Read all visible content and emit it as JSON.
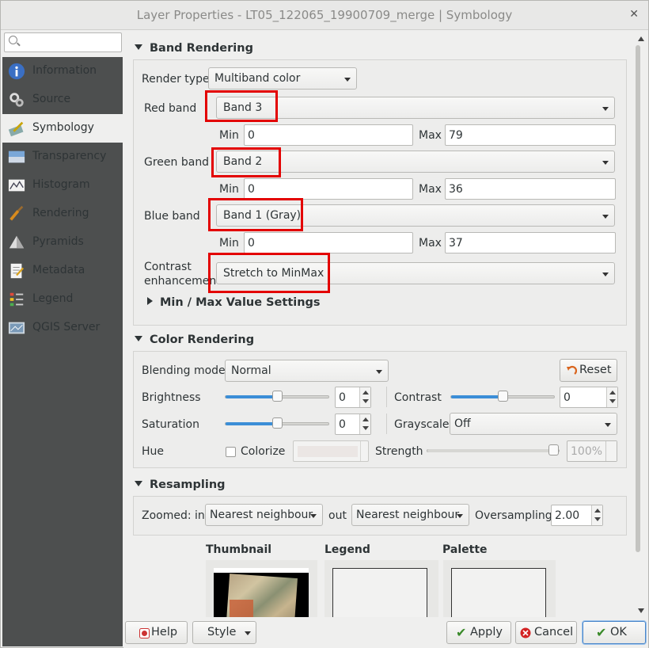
{
  "window": {
    "title": "Layer Properties - LT05_122065_19900709_merge | Symbology",
    "close_glyph": "✕"
  },
  "search": {
    "placeholder": ""
  },
  "sidebar": {
    "items": [
      {
        "label": "Information",
        "icon": "info-icon",
        "selected": false
      },
      {
        "label": "Source",
        "icon": "source-icon",
        "selected": false
      },
      {
        "label": "Symbology",
        "icon": "symbology-icon",
        "selected": true
      },
      {
        "label": "Transparency",
        "icon": "transparency-icon",
        "selected": false
      },
      {
        "label": "Histogram",
        "icon": "histogram-icon",
        "selected": false
      },
      {
        "label": "Rendering",
        "icon": "rendering-icon",
        "selected": false
      },
      {
        "label": "Pyramids",
        "icon": "pyramids-icon",
        "selected": false
      },
      {
        "label": "Metadata",
        "icon": "metadata-icon",
        "selected": false
      },
      {
        "label": "Legend",
        "icon": "legend-icon",
        "selected": false
      },
      {
        "label": "QGIS Server",
        "icon": "qgis-server-icon",
        "selected": false
      }
    ]
  },
  "band_rendering": {
    "header": "Band Rendering",
    "render_type_label": "Render type",
    "render_type_value": "Multiband color",
    "red": {
      "label": "Red band",
      "value": "Band 3",
      "min_label": "Min",
      "min": "0",
      "max_label": "Max",
      "max": "79"
    },
    "green": {
      "label": "Green band",
      "value": "Band 2",
      "min_label": "Min",
      "min": "0",
      "max_label": "Max",
      "max": "36"
    },
    "blue": {
      "label": "Blue band",
      "value": "Band 1 (Gray)",
      "min_label": "Min",
      "min": "0",
      "max_label": "Max",
      "max": "37"
    },
    "contrast_label_1": "Contrast",
    "contrast_label_2": "enhancement",
    "contrast_value": "Stretch to MinMax",
    "minmax_settings": "Min / Max Value Settings"
  },
  "color_rendering": {
    "header": "Color Rendering",
    "blending_label": "Blending mode",
    "blending_value": "Normal",
    "reset_label": "Reset",
    "brightness_label": "Brightness",
    "brightness_value": "0",
    "brightness_level": 0.5,
    "contrast_label": "Contrast",
    "contrast_value": "0",
    "contrast_level": 0.5,
    "saturation_label": "Saturation",
    "saturation_value": "0",
    "saturation_level": 0.5,
    "grayscale_label": "Grayscale",
    "grayscale_value": "Off",
    "hue_label": "Hue",
    "colorize_label": "Colorize",
    "strength_label": "Strength",
    "strength_value": "100%",
    "strength_level": 1.0,
    "accent": "#3b8ed7"
  },
  "resampling": {
    "header": "Resampling",
    "zoomed_in_label": "Zoomed: in",
    "zoomed_in_value": "Nearest neighbour",
    "out_label": "out",
    "out_value": "Nearest neighbour",
    "oversampling_label": "Oversampling",
    "oversampling_value": "2.00"
  },
  "previews": {
    "thumbnail": "Thumbnail",
    "legend": "Legend",
    "palette": "Palette"
  },
  "buttons": {
    "help": "Help",
    "style": "Style",
    "apply": "Apply",
    "cancel": "Cancel",
    "ok": "OK"
  },
  "highlight_color": "#e30000"
}
